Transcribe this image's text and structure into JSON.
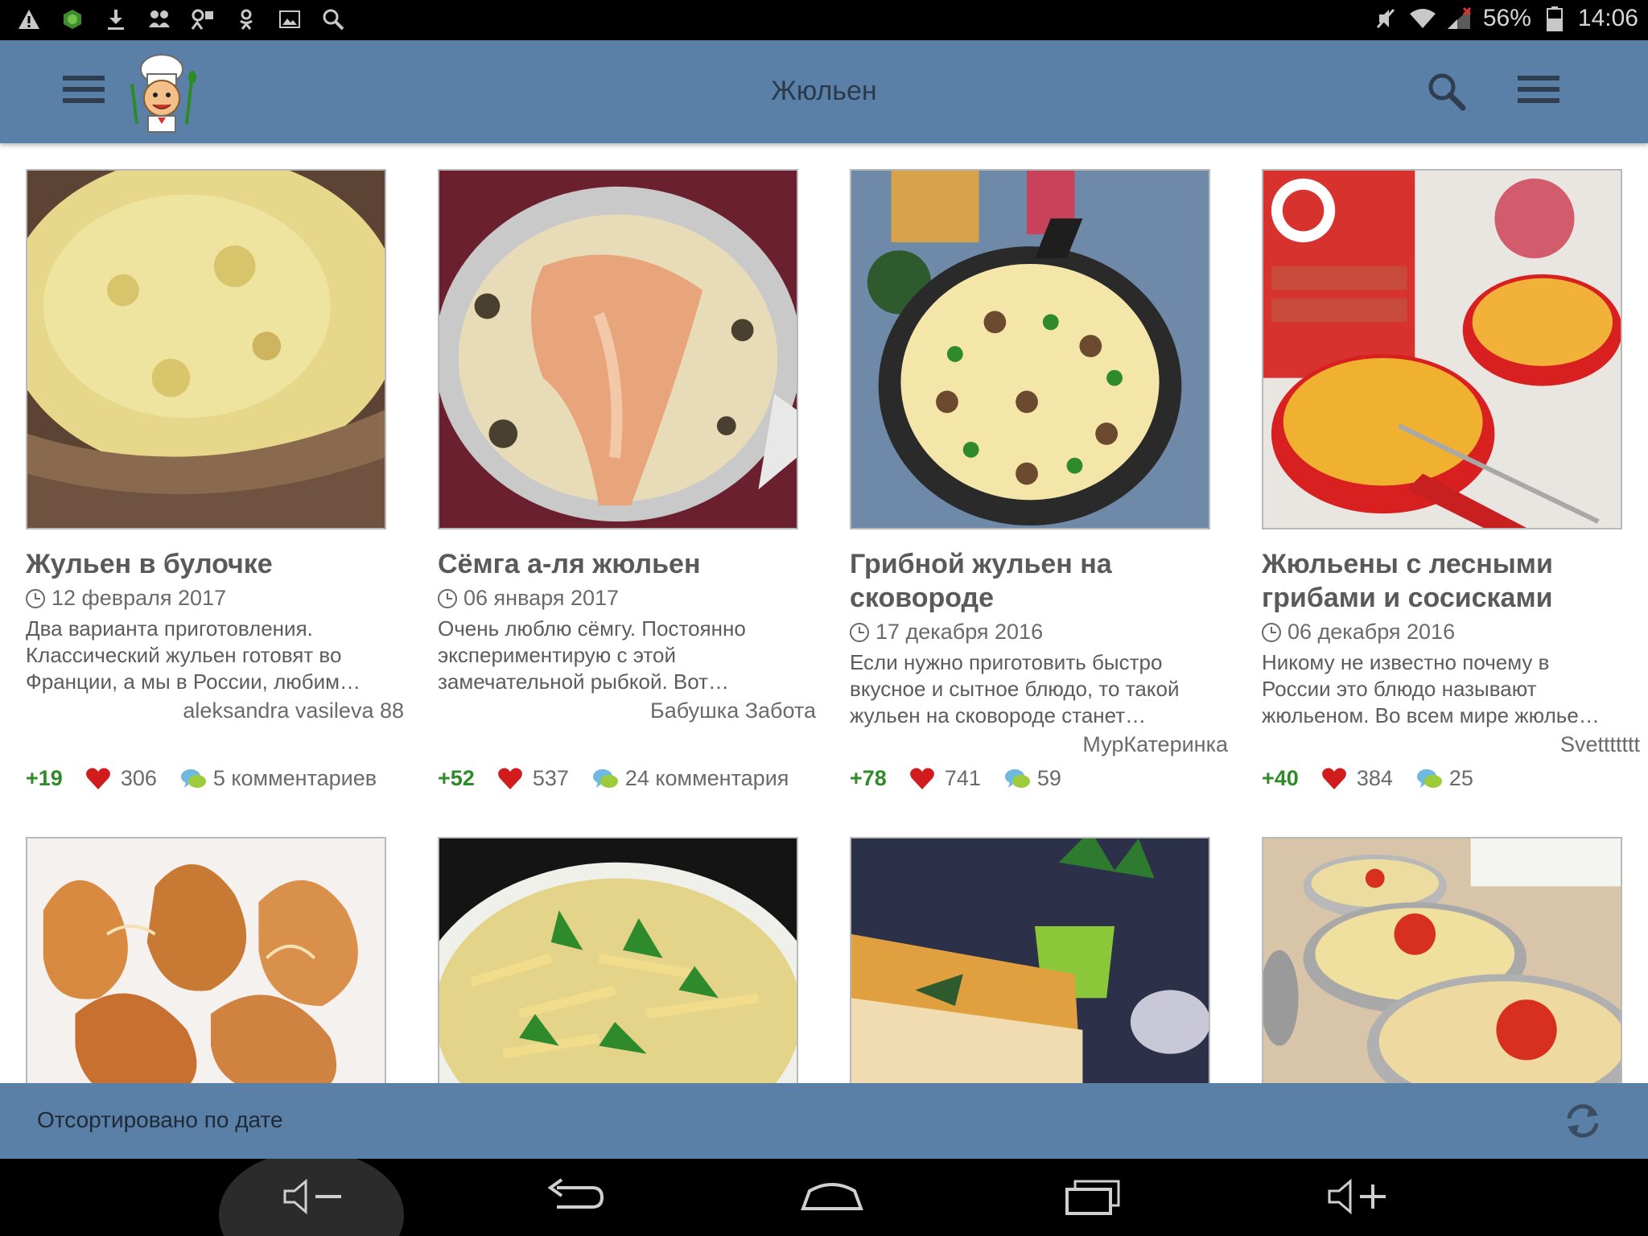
{
  "status_bar": {
    "battery": "56%",
    "time": "14:06",
    "left_icons": [
      "warning-icon",
      "android-icon",
      "download-icon",
      "people-icon",
      "people-sync-icon",
      "odnoklassniki-icon",
      "gallery-icon",
      "search-icon"
    ],
    "right_icons": [
      "mute-icon",
      "wifi-icon",
      "signal-icon",
      "battery-icon"
    ]
  },
  "app_bar": {
    "title": "Жюльен",
    "logo_icon": "chef-logo-icon",
    "left_menu_icon": "hamburger-icon",
    "search_icon": "search-icon",
    "right_menu_icon": "menu-icon",
    "color": "#5a80a8"
  },
  "recipes": [
    {
      "title": "Жульен в булочке",
      "date": "12 февраля 2017",
      "description": "Два варианта приготовления. Классический жульен готовят во Франции, а мы в России, любим…",
      "author": "aleksandra vasileva 88",
      "rating": "+19",
      "likes": "306",
      "comments": "5 комментариев"
    },
    {
      "title": "Сёмга а-ля жюльен",
      "date": "06 января 2017",
      "description": "Очень люблю сёмгу. Постоянно экспериментирую с этой замечательной рыбкой. Вот…",
      "author": "Бабушка Забота",
      "rating": "+52",
      "likes": "537",
      "comments": "24 комментария"
    },
    {
      "title": "Грибной жульен на сковороде",
      "date": "17 декабря 2016",
      "description": "Если нужно приготовить быстро вкусное и сытное блюдо, то такой жульен на сковороде станет…",
      "author": "МурКатеринка",
      "rating": "+78",
      "likes": "741",
      "comments": "59"
    },
    {
      "title": "Жюльены с лесными грибами и сосисками",
      "date": "06 декабря 2016",
      "description": "Никому не известно почему в России это блюдо называют жюльеном. Во всем мире жюлье…",
      "author": "Svettttttt",
      "rating": "+40",
      "likes": "384",
      "comments": "25"
    }
  ],
  "sort_bar": {
    "label": "Отсортировано по дате",
    "refresh_icon": "refresh-icon"
  },
  "nav_bar": {
    "icons": [
      "volume-down-icon",
      "back-icon",
      "home-icon",
      "recents-icon",
      "volume-up-icon"
    ]
  },
  "colors": {
    "accent": "#5a80a8",
    "rating_green": "#2f8a2a",
    "heart_red": "#d01c1c"
  }
}
